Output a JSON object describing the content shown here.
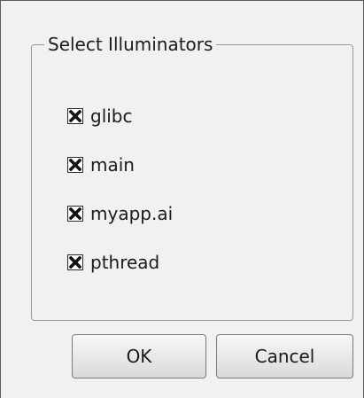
{
  "dialog": {
    "group_title": "Select Illuminators",
    "items": [
      {
        "label": "glibc",
        "checked": true
      },
      {
        "label": "main",
        "checked": true
      },
      {
        "label": "myapp.ai",
        "checked": true
      },
      {
        "label": "pthread",
        "checked": true
      }
    ],
    "ok_label": "OK",
    "cancel_label": "Cancel"
  }
}
